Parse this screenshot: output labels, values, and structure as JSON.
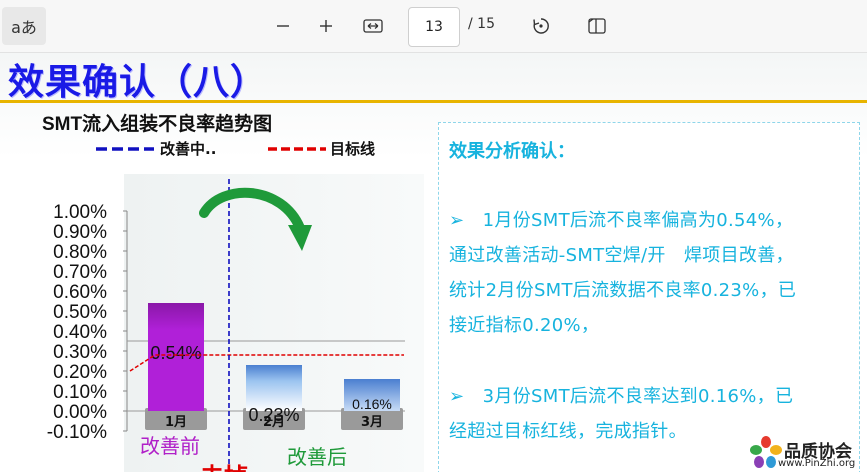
{
  "toolbar": {
    "read_aloud_label": "aあ",
    "page_current": "13",
    "page_total": "/ 15"
  },
  "slide": {
    "title": "效果确认（八）",
    "chart_title": "SMT流入组装不良率趋势图",
    "legend": {
      "improving": "改善中..",
      "target": "目标线"
    },
    "labels": {
      "before": "改善前",
      "after": "改善后",
      "cut_text": "去掉"
    }
  },
  "chart_data": {
    "type": "bar",
    "categories": [
      "1月",
      "2月",
      "3月"
    ],
    "values": [
      0.54,
      0.23,
      0.16
    ],
    "value_labels": [
      "0.54%",
      "0.23%",
      "0.16%"
    ],
    "ylim": [
      -0.1,
      1.0
    ],
    "y_ticks": [
      "1.00%",
      "0.90%",
      "0.80%",
      "0.70%",
      "0.60%",
      "0.50%",
      "0.40%",
      "0.30%",
      "0.20%",
      "0.10%",
      "0.00%",
      "-0.10%"
    ],
    "target_line": 0.28,
    "target_line_start": 0.2,
    "colors": {
      "bar1": "#a018c8",
      "bar2": "#4c86d6",
      "bar3": "#4c86d6",
      "target": "#e00000",
      "improving": "#1010c0",
      "arrow": "#1f9a3a"
    }
  },
  "analysis": {
    "heading": "效果分析确认：",
    "para1_line1": "➢　1月份SMT后流不良率偏高为0.54%，",
    "para1_line2": "通过改善活动-SMT空焊/开　焊项目改善，",
    "para1_line3": "统计2月份SMT后流数据不良率0.23%，已",
    "para1_line4": "接近指标0.20%，",
    "para2_line1": "➢　3月份SMT后流不良率达到0.16%，已",
    "para2_line2": "经超过目标红线，完成指针。"
  },
  "logo": {
    "name": "品质协会",
    "url": "www.PinZhi.org"
  }
}
